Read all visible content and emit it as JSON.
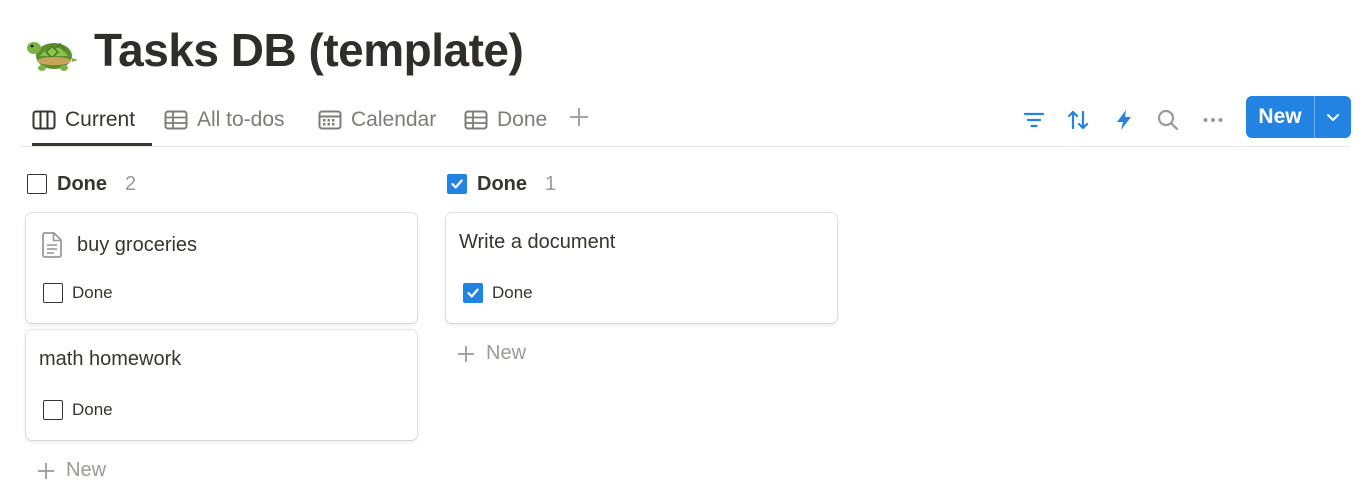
{
  "page": {
    "title": "Tasks DB (template)",
    "icon": "turtle-icon"
  },
  "views": [
    {
      "label": "Current",
      "icon": "board-icon",
      "active": true
    },
    {
      "label": "All to-dos",
      "icon": "table-icon",
      "active": false
    },
    {
      "label": "Calendar",
      "icon": "calendar-icon",
      "active": false
    },
    {
      "label": "Done",
      "icon": "table-icon",
      "active": false
    }
  ],
  "toolbar": {
    "icons": [
      "filter-icon",
      "sort-icon",
      "automation-icon",
      "search-icon",
      "more-icon"
    ],
    "new_label": "New"
  },
  "colors": {
    "accent": "#2383e2",
    "text": "#37352f",
    "muted": "#9b9a97"
  },
  "board": {
    "groups": [
      {
        "label": "Done",
        "count": "2",
        "checked": false,
        "cards": [
          {
            "title": "buy groceries",
            "has_page_icon": true,
            "prop_label": "Done",
            "checked": false
          },
          {
            "title": "math homework",
            "has_page_icon": false,
            "prop_label": "Done",
            "checked": false
          }
        ],
        "add_label": "New"
      },
      {
        "label": "Done",
        "count": "1",
        "checked": true,
        "cards": [
          {
            "title": "Write a document",
            "has_page_icon": false,
            "prop_label": "Done",
            "checked": true
          }
        ],
        "add_label": "New"
      }
    ]
  }
}
